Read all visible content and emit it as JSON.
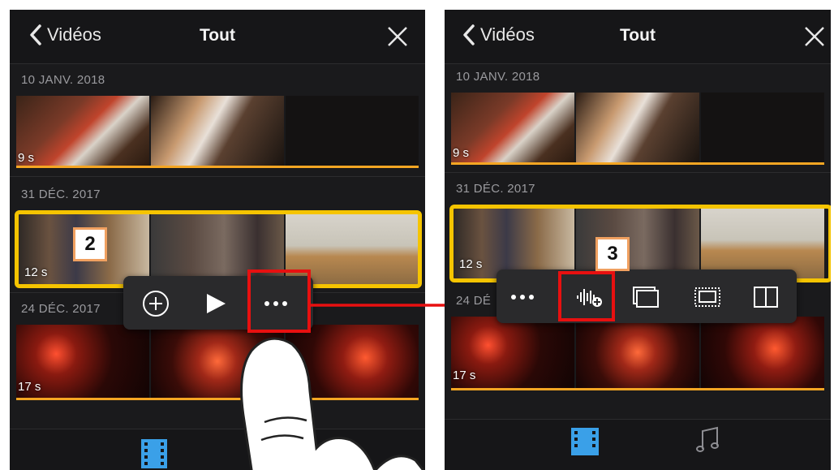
{
  "left": {
    "header": {
      "back_label": "Vidéos",
      "title": "Tout"
    },
    "sections": [
      {
        "date": "10 JANV. 2018",
        "duration": "9 s"
      },
      {
        "date": "31 DÉC. 2017",
        "duration": "12 s"
      },
      {
        "date": "24 DÉC. 2017",
        "duration": "17 s"
      }
    ],
    "step_number": "2"
  },
  "right": {
    "header": {
      "back_label": "Vidéos",
      "title": "Tout"
    },
    "sections": [
      {
        "date": "10 JANV. 2018",
        "duration": "9 s"
      },
      {
        "date": "31 DÉC. 2017",
        "duration": "12 s"
      },
      {
        "date": "24 DÉ",
        "duration": "17 s"
      }
    ],
    "step_number": "3"
  },
  "colors": {
    "accent_orange": "#f5a623",
    "selection_yellow": "#f5c400",
    "highlight_red": "#e81010",
    "tab_blue": "#3aa0e8"
  },
  "icons": [
    "chevron-left-icon",
    "close-icon",
    "add-circle-icon",
    "play-icon",
    "more-icon",
    "audio-detach-icon",
    "fullscreen-frame-icon",
    "cutaway-icon",
    "split-screen-icon",
    "film-icon",
    "music-note-icon"
  ]
}
